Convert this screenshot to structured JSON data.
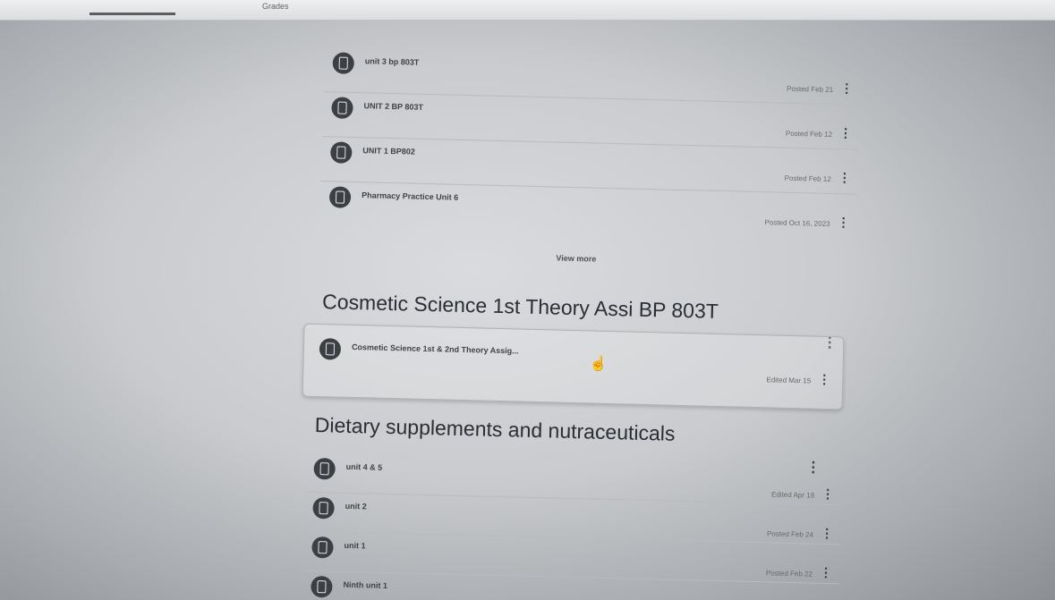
{
  "top_tab": "Grades",
  "first_section": {
    "items": [
      {
        "title": "unit 3 bp 803T",
        "date": "Posted Feb 21"
      },
      {
        "title": "UNIT 2 BP 803T",
        "date": "Posted Feb 12"
      },
      {
        "title": "UNIT 1 BP802",
        "date": "Posted Feb 12"
      },
      {
        "title": "Pharmacy Practice Unit 6",
        "date": "Posted Oct 16, 2023"
      }
    ],
    "view_more": "View more"
  },
  "cosmetic_section": {
    "title": "Cosmetic Science 1st Theory Assi BP 803T",
    "item": {
      "title": "Cosmetic Science 1st & 2nd Theory Assig...",
      "date": "Edited Mar 15"
    }
  },
  "dietary_section": {
    "title": "Dietary supplements and nutraceuticals",
    "items": [
      {
        "title": "unit 4 & 5",
        "date": "Edited Apr 18"
      },
      {
        "title": "unit 2",
        "date": "Posted Feb 24"
      },
      {
        "title": "unit 1",
        "date": "Posted Feb 22"
      },
      {
        "title": "Ninth unit 1",
        "date": ""
      }
    ]
  },
  "icons": {
    "item": "assignment-icon",
    "more": "more-vertical-icon",
    "cursor": "hand-pointer-icon"
  }
}
